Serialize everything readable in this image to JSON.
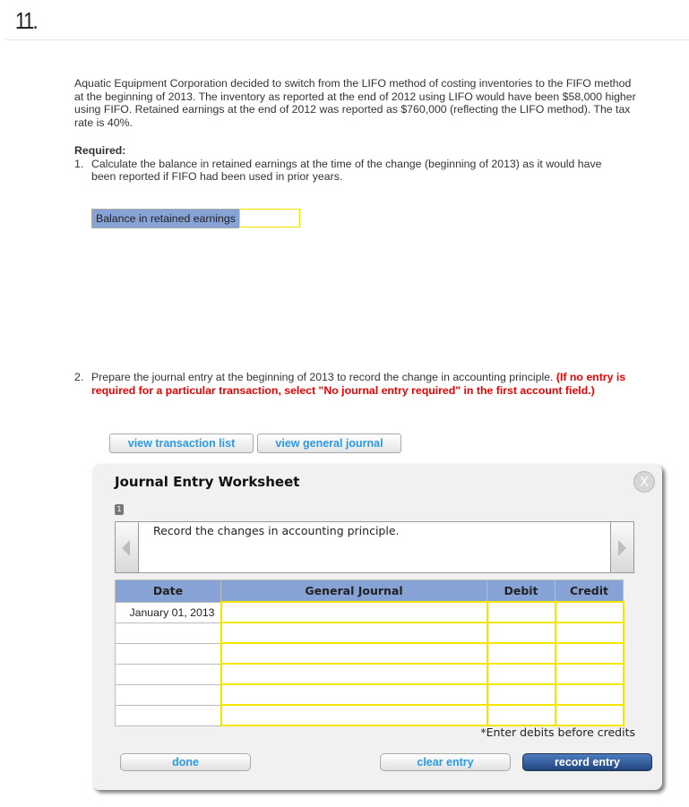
{
  "question_number": "11.",
  "problem": {
    "intro": "Aquatic Equipment Corporation decided to switch from the LIFO method of costing inventories to the FIFO method at the beginning of 2013. The inventory as reported at the end of 2012 using LIFO would have been $58,000 higher using FIFO. Retained earnings at the end of 2012 was reported as $760,000 (reflecting the LIFO method). The tax rate is 40%.",
    "required_label": "Required:",
    "req1_num": "1.",
    "req1_text": "Calculate the balance in retained earnings at the time of the change (beginning of 2013) as it would have been reported if FIFO had been used in prior years.",
    "balance_label": "Balance in retained earnings",
    "balance_value": "",
    "req2_num": "2.",
    "req2_text": "Prepare the journal entry at the beginning of 2013 to record the change in accounting principle. ",
    "req2_note": "(If no entry is required for a particular transaction, select \"No journal entry required\" in the first account field.)"
  },
  "buttons": {
    "view_transaction_list": "view transaction list",
    "view_general_journal": "view general journal"
  },
  "worksheet": {
    "title": "Journal Entry Worksheet",
    "close_label": "X",
    "step_badge": "1",
    "instruction": "Record the changes in accounting principle.",
    "columns": [
      "Date",
      "General Journal",
      "Debit",
      "Credit"
    ],
    "rows": [
      {
        "date": "January 01, 2013",
        "account": "",
        "debit": "",
        "credit": ""
      },
      {
        "date": "",
        "account": "",
        "debit": "",
        "credit": ""
      },
      {
        "date": "",
        "account": "",
        "debit": "",
        "credit": ""
      },
      {
        "date": "",
        "account": "",
        "debit": "",
        "credit": ""
      },
      {
        "date": "",
        "account": "",
        "debit": "",
        "credit": ""
      },
      {
        "date": "",
        "account": "",
        "debit": "",
        "credit": ""
      }
    ],
    "note": "*Enter debits before credits",
    "done_label": "done",
    "clear_label": "clear entry",
    "record_label": "record entry"
  }
}
